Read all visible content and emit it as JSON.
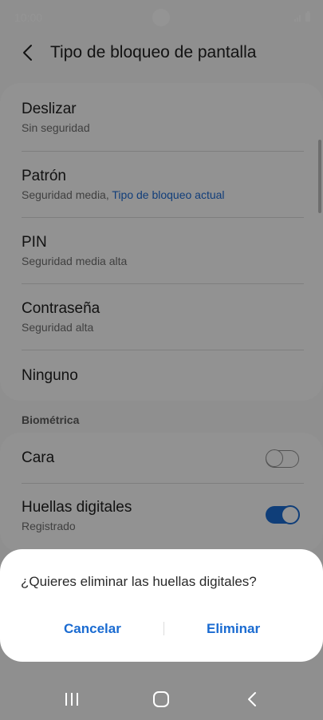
{
  "status_bar": {
    "time": "10:00"
  },
  "header": {
    "title": "Tipo de bloqueo de pantalla"
  },
  "lock_options": [
    {
      "title": "Deslizar",
      "subtitle": "Sin seguridad"
    },
    {
      "title": "Patrón",
      "subtitle": "Seguridad media,",
      "subtitle_link": "Tipo de bloqueo actual"
    },
    {
      "title": "PIN",
      "subtitle": "Seguridad media alta"
    },
    {
      "title": "Contraseña",
      "subtitle": "Seguridad alta"
    },
    {
      "title": "Ninguno"
    }
  ],
  "biometrics": {
    "section_label": "Biométrica",
    "items": [
      {
        "title": "Cara",
        "enabled": false
      },
      {
        "title": "Huellas digitales",
        "subtitle": "Registrado",
        "enabled": true
      }
    ]
  },
  "dialog": {
    "message": "¿Quieres eliminar las huellas digitales?",
    "cancel_label": "Cancelar",
    "confirm_label": "Eliminar"
  },
  "colors": {
    "accent": "#1a6bd1",
    "link": "#1e6bd3",
    "overlay": "rgba(0,0,0,0.42)"
  },
  "navigation_bar": {
    "icons": [
      "recent-apps-icon",
      "home-icon",
      "back-icon"
    ]
  }
}
